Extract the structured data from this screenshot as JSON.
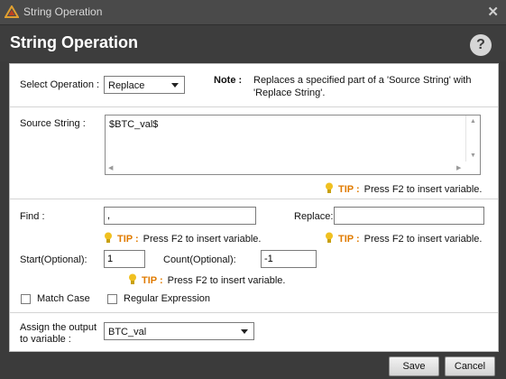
{
  "window": {
    "title": "String Operation",
    "close_glyph": "✕"
  },
  "header": {
    "title": "String Operation",
    "help_glyph": "?"
  },
  "operation": {
    "label": "Select Operation :",
    "selected": "Replace"
  },
  "note": {
    "label": "Note :",
    "text_line1": "Replaces a specified part of a 'Source String' with",
    "text_line2": "'Replace String'."
  },
  "source": {
    "label": "Source String :",
    "value": "$BTC_val$"
  },
  "tip": {
    "word": "TIP :",
    "text": "Press F2 to insert variable."
  },
  "find": {
    "label": "Find :",
    "value": ","
  },
  "replace": {
    "label": "Replace:",
    "value": ""
  },
  "start": {
    "label": "Start(Optional):",
    "value": "1"
  },
  "count": {
    "label": "Count(Optional):",
    "value": "-1"
  },
  "match_case": {
    "label": "Match Case",
    "checked": false
  },
  "regex": {
    "label": "Regular Expression",
    "checked": false
  },
  "assign": {
    "label_line1": "Assign the output",
    "label_line2": "to variable :",
    "selected": "BTC_val"
  },
  "buttons": {
    "save": "Save",
    "cancel": "Cancel"
  },
  "colors": {
    "tip_accent": "#e07b00",
    "bulb": "#f0c020",
    "title_bg": "#3d3d3d"
  }
}
